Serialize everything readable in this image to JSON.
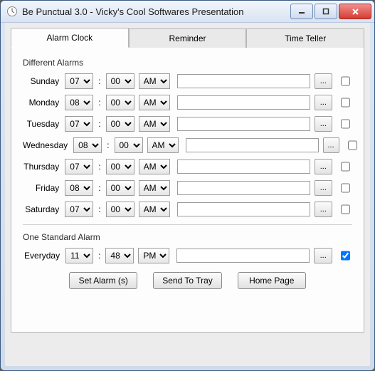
{
  "window": {
    "title": "Be Punctual 3.0 - Vicky's Cool Softwares Presentation"
  },
  "tabs": [
    {
      "label": "Alarm Clock",
      "active": true
    },
    {
      "label": "Reminder",
      "active": false
    },
    {
      "label": "Time Teller",
      "active": false
    }
  ],
  "sections": {
    "different": "Different Alarms",
    "standard": "One Standard Alarm"
  },
  "alarms": [
    {
      "day": "Sunday",
      "hour": "07",
      "min": "00",
      "ampm": "AM",
      "note": "",
      "checked": false
    },
    {
      "day": "Monday",
      "hour": "08",
      "min": "00",
      "ampm": "AM",
      "note": "",
      "checked": false
    },
    {
      "day": "Tuesday",
      "hour": "07",
      "min": "00",
      "ampm": "AM",
      "note": "",
      "checked": false
    },
    {
      "day": "Wednesday",
      "hour": "08",
      "min": "00",
      "ampm": "AM",
      "note": "",
      "checked": false
    },
    {
      "day": "Thursday",
      "hour": "07",
      "min": "00",
      "ampm": "AM",
      "note": "",
      "checked": false
    },
    {
      "day": "Friday",
      "hour": "08",
      "min": "00",
      "ampm": "AM",
      "note": "",
      "checked": false
    },
    {
      "day": "Saturday",
      "hour": "07",
      "min": "00",
      "ampm": "AM",
      "note": "",
      "checked": false
    }
  ],
  "standard_alarm": {
    "day": "Everyday",
    "hour": "11",
    "min": "48",
    "ampm": "PM",
    "note": "",
    "checked": true
  },
  "buttons": {
    "browse": "...",
    "set": "Set Alarm (s)",
    "tray": "Send To Tray",
    "home": "Home Page"
  }
}
